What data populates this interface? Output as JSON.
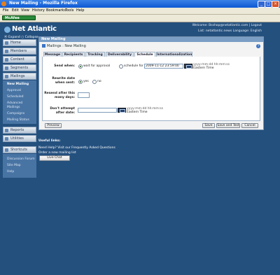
{
  "window": {
    "title": "New Mailing - Mozilla Firefox",
    "min": "_",
    "max": "□",
    "close": "×"
  },
  "menu": [
    "File",
    "Edit",
    "View",
    "History",
    "Bookmarks",
    "Tools",
    "Help"
  ],
  "toolbar": {
    "mcafee": "McAfee"
  },
  "header": {
    "logo": "Net Atlantic",
    "welcome": "Welcome: Bsshop@netatlantic.com | Logout",
    "list_line": "List: netatlantic.news Language: English"
  },
  "expand": {
    "expand": "Expand",
    "collapse": "Collapse"
  },
  "sidebar": {
    "home": "Home",
    "members": "Members",
    "content": "Content",
    "segments": "Segments",
    "mailings": "Mailings",
    "mailing_sub": [
      "New Mailing",
      "Approval",
      "Scheduled",
      "Advanced Mailings",
      "Campaigns",
      "Mailing Status"
    ],
    "reports": "Reports",
    "utilities": "Utilities",
    "shortcuts": "Shortcuts",
    "shortcut_sub": [
      "Discussion Forum",
      "Site Map",
      "Help"
    ]
  },
  "main": {
    "header": "New Mailing",
    "breadcrumb": "Mailings : New Mailing",
    "help": "?",
    "tabs": [
      "Message",
      "Recipients",
      "Tracking",
      "Deliverability",
      "Schedule",
      "Internationalization"
    ],
    "selected_tab": "Schedule",
    "send_when_label": "Send when:",
    "wait_approval": "wait for approval",
    "schedule_for": "schedule for",
    "schedule_value": "2009-11-12 23:59:00",
    "date_format": "yyyy-mm-dd hh:mm:ss",
    "tz": "Eastern Time",
    "rewrite_label": "Rewrite date when sent:",
    "yes": "yes",
    "no": "no",
    "resend_label": "Resend after this many days:",
    "resend_value": "",
    "dont_attempt_label": "Don't attempt after date:",
    "dont_attempt_value": "",
    "preview": "Preview",
    "save": "Save",
    "save_test": "Save and Test",
    "cancel": "Cancel"
  },
  "useful": {
    "title": "Useful links:",
    "items": [
      "Need Help? Visit our Frequently Asked Questions",
      "Order a new mailing list"
    ],
    "live_chat": "Live Chat"
  }
}
